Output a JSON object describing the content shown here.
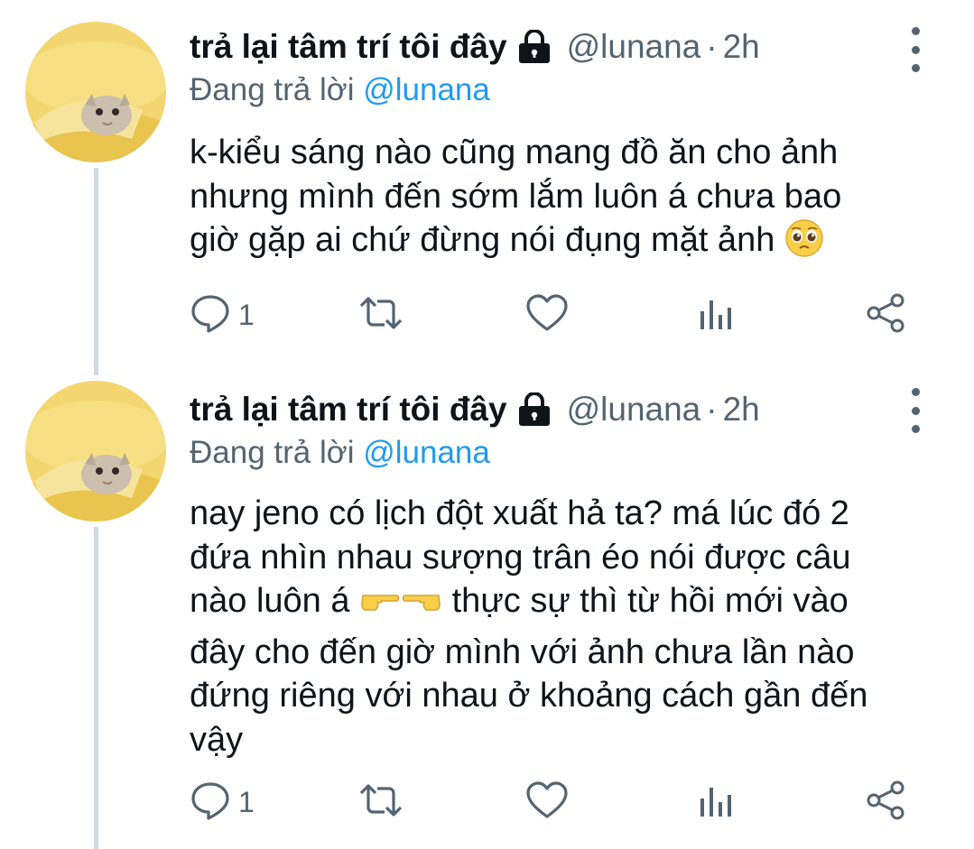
{
  "tweets": [
    {
      "display_name": "trả lại tâm trí tôi đây",
      "handle": "@lunana",
      "separator": "·",
      "time": "2h",
      "reply_prefix": "Đang trả lời ",
      "reply_mention": "@lunana",
      "lines": [
        "k-kiểu sáng nào cũng mang đồ ăn cho ảnh",
        "nhưng mình đến sớm lắm luôn á chưa bao",
        "giờ gặp ai chứ đừng nói đụng mặt ảnh"
      ],
      "inline_emoji": "pleading-face",
      "reply_count": "1"
    },
    {
      "display_name": "trả lại tâm trí tôi đây",
      "handle": "@lunana",
      "separator": "·",
      "time": "2h",
      "reply_prefix": "Đang trả lời ",
      "reply_mention": "@lunana",
      "lines": [
        "nay jeno có lịch đột xuất hả ta? má lúc đó 2",
        "đứa nhìn nhau sượng trân éo nói được câu",
        "nào luôn á",
        "thực sự thì từ hồi mới vào",
        "đây cho đến giờ mình với ảnh chưa lần nào",
        "đứng riêng với nhau ở khoảng cách gần đến",
        "vậy"
      ],
      "inline_emoji": "pointing-fingers",
      "reply_count": "1"
    }
  ],
  "icons": [
    "lock-icon",
    "more-icon",
    "reply-icon",
    "retweet-icon",
    "like-icon",
    "analytics-icon",
    "share-icon"
  ],
  "colors": {
    "text": "#0f1419",
    "secondary": "#536471",
    "link": "#1d9bf0",
    "thread_line": "#cfd9de"
  }
}
